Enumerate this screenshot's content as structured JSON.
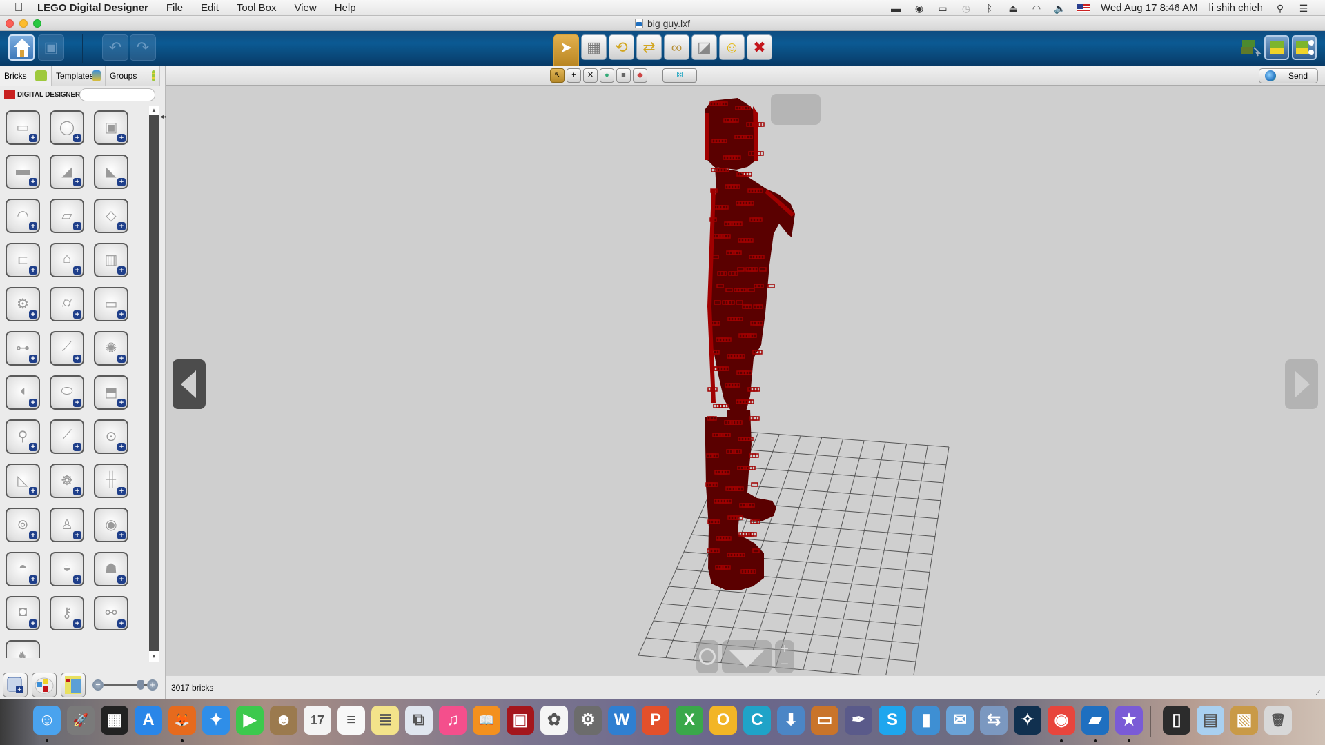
{
  "menubar": {
    "app_name": "LEGO Digital Designer",
    "items": [
      "File",
      "Edit",
      "Tool Box",
      "View",
      "Help"
    ],
    "status_icons": [
      "printer-icon",
      "eye-icon",
      "airplay-icon",
      "time-machine-icon",
      "bluetooth-icon",
      "eject-icon",
      "wifi-icon",
      "volume-icon",
      "us-flag-icon"
    ],
    "datetime": "Wed Aug 17  8:46 AM",
    "user": "li shih chieh"
  },
  "window": {
    "title": "big guy.lxf"
  },
  "toolbar": {
    "left_buttons": [
      {
        "name": "home",
        "icon": "home-icon",
        "enabled": true
      },
      {
        "name": "save",
        "icon": "save-icon",
        "enabled": false
      },
      {
        "name": "undo",
        "icon": "undo-icon",
        "enabled": false
      },
      {
        "name": "redo",
        "icon": "redo-icon",
        "enabled": false
      }
    ],
    "tools": [
      {
        "name": "select",
        "icon": "cursor-icon",
        "glyph": "➤",
        "selected": true
      },
      {
        "name": "clone",
        "icon": "clone-brick-icon",
        "glyph": "▦",
        "selected": false
      },
      {
        "name": "hinge",
        "icon": "hinge-icon",
        "glyph": "⟲",
        "selected": false
      },
      {
        "name": "hinge-align",
        "icon": "hinge-align-icon",
        "glyph": "⇄",
        "selected": false
      },
      {
        "name": "flex",
        "icon": "flex-icon",
        "glyph": "∞",
        "selected": false
      },
      {
        "name": "paint",
        "icon": "paint-bucket-icon",
        "glyph": "◪",
        "selected": false
      },
      {
        "name": "decorate",
        "icon": "decoration-icon",
        "glyph": "☺",
        "selected": false
      },
      {
        "name": "delete",
        "icon": "delete-icon",
        "glyph": "✖",
        "selected": false
      }
    ],
    "right_buttons": [
      {
        "name": "build-mode",
        "icon": "build-mode-icon"
      },
      {
        "name": "view-mode",
        "icon": "view-mode-icon"
      },
      {
        "name": "building-guide-mode",
        "icon": "building-guide-icon"
      }
    ]
  },
  "secondary_toolbar": {
    "select_modes": [
      {
        "name": "single-select",
        "glyph": "↖",
        "selected": true
      },
      {
        "name": "multi-select",
        "glyph": "+",
        "selected": false
      },
      {
        "name": "invert-select",
        "glyph": "✕",
        "selected": false
      },
      {
        "name": "color-select",
        "glyph": "●",
        "selected": false
      },
      {
        "name": "shape-select",
        "glyph": "■",
        "selected": false
      },
      {
        "name": "color-shape-select",
        "glyph": "◆",
        "selected": false
      }
    ],
    "group_button_glyph": "⚄",
    "send_label": "Send"
  },
  "sidebar": {
    "tabs": [
      {
        "label": "Bricks",
        "active": true,
        "color": "#9ec93c"
      },
      {
        "label": "Templates",
        "active": false,
        "color": "#3b8fd8"
      },
      {
        "label": "Groups",
        "active": false,
        "color": "#9ec93c"
      }
    ],
    "brand_label": "DIGITAL DESIGNER",
    "search_value": "",
    "search_placeholder": "",
    "bricks": [
      {
        "name": "brick",
        "glyph": "▭"
      },
      {
        "name": "round-brick",
        "glyph": "◯"
      },
      {
        "name": "brick-with-stud",
        "glyph": "▣"
      },
      {
        "name": "technic-brick",
        "glyph": "▬"
      },
      {
        "name": "slope",
        "glyph": "◢"
      },
      {
        "name": "wedge",
        "glyph": "◣"
      },
      {
        "name": "curved-brick",
        "glyph": "◠"
      },
      {
        "name": "plate",
        "glyph": "▱"
      },
      {
        "name": "wedge-plate",
        "glyph": "◇"
      },
      {
        "name": "bracket",
        "glyph": "⊏"
      },
      {
        "name": "tile-hinge",
        "glyph": "⌂"
      },
      {
        "name": "door-window",
        "glyph": "▥"
      },
      {
        "name": "wheel",
        "glyph": "⚙"
      },
      {
        "name": "cylinder",
        "glyph": "⌭"
      },
      {
        "name": "technic-beam",
        "glyph": "▭"
      },
      {
        "name": "technic-liftarm",
        "glyph": "⊶"
      },
      {
        "name": "technic-axle",
        "glyph": "⟋"
      },
      {
        "name": "gear",
        "glyph": "✺"
      },
      {
        "name": "vehicle-part",
        "glyph": "◖"
      },
      {
        "name": "cone",
        "glyph": "⬭"
      },
      {
        "name": "roof-tile",
        "glyph": "⬒"
      },
      {
        "name": "tool-arm",
        "glyph": "⚲"
      },
      {
        "name": "tail-fin",
        "glyph": "⟋"
      },
      {
        "name": "hoop",
        "glyph": "⊙"
      },
      {
        "name": "wing",
        "glyph": "◺"
      },
      {
        "name": "ship-wheel",
        "glyph": "☸"
      },
      {
        "name": "train-track",
        "glyph": "╫"
      },
      {
        "name": "spool",
        "glyph": "⊚"
      },
      {
        "name": "minifigure",
        "glyph": "♙"
      },
      {
        "name": "minifig-head",
        "glyph": "◉"
      },
      {
        "name": "helmet",
        "glyph": "◓"
      },
      {
        "name": "hat",
        "glyph": "◒"
      },
      {
        "name": "skeleton",
        "glyph": "☗"
      },
      {
        "name": "armor",
        "glyph": "◘"
      },
      {
        "name": "key",
        "glyph": "⚷"
      },
      {
        "name": "cherries",
        "glyph": "⚯"
      },
      {
        "name": "animal",
        "glyph": "♞"
      }
    ],
    "bottom_buttons": [
      {
        "name": "add-model",
        "icon": "add-model-icon"
      },
      {
        "name": "color-palette",
        "icon": "color-palette-icon"
      },
      {
        "name": "brick-set",
        "icon": "brick-set-icon"
      }
    ],
    "zoom_slider_value": 0.85
  },
  "canvas": {
    "model_color": "#a00000",
    "model_shadow_color": "#5a0000",
    "grid_color": "#555555",
    "grid_columns": 10,
    "grid_rows": 13
  },
  "status": {
    "brick_count": "3017 bricks"
  },
  "dock": {
    "apps": [
      {
        "name": "Finder",
        "color": "#4aa3ee",
        "glyph": "☺",
        "running": true
      },
      {
        "name": "Launchpad",
        "color": "#7a7a7a",
        "glyph": "🚀",
        "running": false
      },
      {
        "name": "Mission Control",
        "color": "#222",
        "glyph": "▦",
        "running": false
      },
      {
        "name": "App Store",
        "color": "#2a86e8",
        "glyph": "A",
        "running": false
      },
      {
        "name": "Firefox",
        "color": "#e66a1d",
        "glyph": "🦊",
        "running": true
      },
      {
        "name": "Safari",
        "color": "#2f8ee8",
        "glyph": "✦",
        "running": false
      },
      {
        "name": "FaceTime",
        "color": "#3cc94d",
        "glyph": "▶",
        "running": false
      },
      {
        "name": "Contacts",
        "color": "#9b7a4e",
        "glyph": "☻",
        "running": false
      },
      {
        "name": "Calendar",
        "color": "#f4f4f4",
        "glyph": "17",
        "running": false
      },
      {
        "name": "Reminders",
        "color": "#f8f8f8",
        "glyph": "≡",
        "running": false
      },
      {
        "name": "Notes",
        "color": "#f3e38a",
        "glyph": "≣",
        "running": false
      },
      {
        "name": "Preview",
        "color": "#e0e6ef",
        "glyph": "⧉",
        "running": false
      },
      {
        "name": "iTunes",
        "color": "#f44f8c",
        "glyph": "♫",
        "running": false
      },
      {
        "name": "iBooks",
        "color": "#f3901e",
        "glyph": "📖",
        "running": false
      },
      {
        "name": "Photo Booth",
        "color": "#a4161c",
        "glyph": "▣",
        "running": false
      },
      {
        "name": "Photos",
        "color": "#f5f5f5",
        "glyph": "✿",
        "running": false
      },
      {
        "name": "System Preferences",
        "color": "#6c6c6c",
        "glyph": "⚙",
        "running": false
      },
      {
        "name": "Microsoft Word",
        "color": "#2f7fd1",
        "glyph": "W",
        "running": false
      },
      {
        "name": "Microsoft PowerPoint",
        "color": "#e3502b",
        "glyph": "P",
        "running": false
      },
      {
        "name": "Microsoft Excel",
        "color": "#3aa84a",
        "glyph": "X",
        "running": false
      },
      {
        "name": "Microsoft Outlook",
        "color": "#f2b526",
        "glyph": "O",
        "running": false
      },
      {
        "name": "Cisco Webex",
        "color": "#1fa3c8",
        "glyph": "C",
        "running": false
      },
      {
        "name": "Download Manager",
        "color": "#4b86c6",
        "glyph": "⬇",
        "running": false
      },
      {
        "name": "Keynote",
        "color": "#c9742a",
        "glyph": "▭",
        "running": false
      },
      {
        "name": "Script Editor",
        "color": "#5a5a8a",
        "glyph": "✒",
        "running": false
      },
      {
        "name": "Skype",
        "color": "#1ea6ee",
        "glyph": "S",
        "running": false
      },
      {
        "name": "Numbers",
        "color": "#3e8fd3",
        "glyph": "▮",
        "running": false
      },
      {
        "name": "Mail",
        "color": "#6aa2d6",
        "glyph": "✉",
        "running": false
      },
      {
        "name": "Migration Assistant",
        "color": "#7b98c0",
        "glyph": "⇆",
        "running": false
      },
      {
        "name": "Battle.net",
        "color": "#10304f",
        "glyph": "✧",
        "running": false
      },
      {
        "name": "Google Chrome",
        "color": "#e8453c",
        "glyph": "◉",
        "running": true
      },
      {
        "name": "LEGO Digital Designer",
        "color": "#1e6fc0",
        "glyph": "▰",
        "running": true
      },
      {
        "name": "iMovie",
        "color": "#7a5bd6",
        "glyph": "★",
        "running": true
      },
      {
        "name": "iPhone Backup",
        "color": "#2c2c2c",
        "glyph": "▯",
        "running": false
      },
      {
        "name": "Documents",
        "color": "#a9d0f0",
        "glyph": "▤",
        "running": false
      },
      {
        "name": "Installer",
        "color": "#c99a47",
        "glyph": "▧",
        "running": false
      },
      {
        "name": "Trash",
        "color": "#d8d8d8",
        "glyph": "🗑",
        "running": false
      }
    ]
  }
}
